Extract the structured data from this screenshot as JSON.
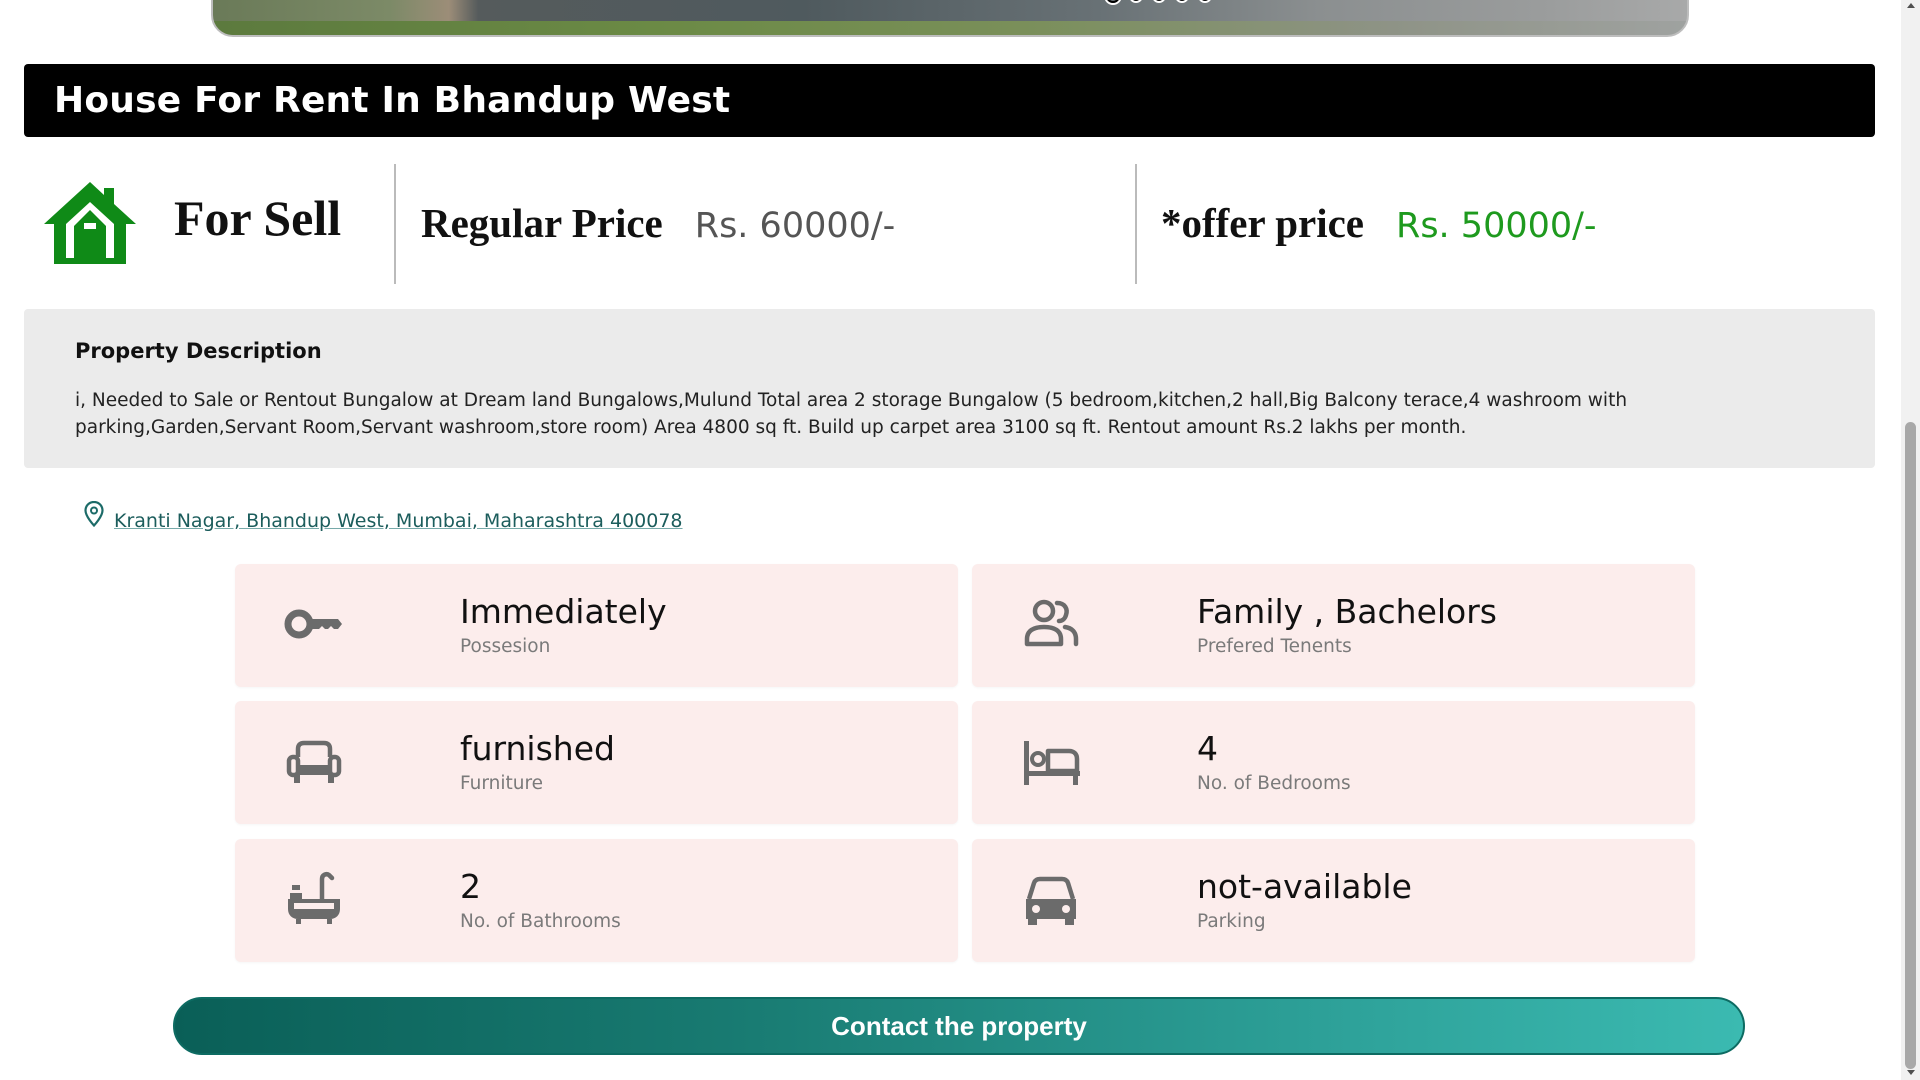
{
  "carousel": {
    "slide_count": 5,
    "active_index": 0
  },
  "header": {
    "title": "House For Rent In Bhandup West"
  },
  "pricing": {
    "sale_type": "For Sell",
    "regular_label": "Regular Price",
    "regular_value": "Rs. 60000/-",
    "offer_label": "*offer price",
    "offer_value": "Rs. 50000/-"
  },
  "description": {
    "heading": "Property Description",
    "text": "i, Needed to Sale or Rentout Bungalow at Dream land Bungalows,Mulund Total area 2 storage Bungalow (5 bedroom,kitchen,2 hall,Big Balcony terace,4 washroom with parking,Garden,Servant Room,Servant washroom,store room) Area 4800 sq ft. Build up carpet area 3100 sq ft. Rentout amount Rs.2 lakhs per month."
  },
  "address": {
    "text": "Kranti Nagar, Bhandup West, Mumbai, Maharashtra 400078"
  },
  "features": [
    {
      "icon": "key-icon",
      "value": "Immediately",
      "label": "Possesion"
    },
    {
      "icon": "people-icon",
      "value": "Family , Bachelors",
      "label": "Prefered Tenents"
    },
    {
      "icon": "sofa-icon",
      "value": "furnished",
      "label": "Furniture"
    },
    {
      "icon": "bed-icon",
      "value": "4",
      "label": "No. of Bedrooms"
    },
    {
      "icon": "bathtub-icon",
      "value": "2",
      "label": "No. of Bathrooms"
    },
    {
      "icon": "car-icon",
      "value": "not-available",
      "label": "Parking"
    }
  ],
  "contact": {
    "label": "Contact the property"
  },
  "colors": {
    "offer_green": "#1e9a1e",
    "house_green": "#0f8a17",
    "card_bg": "#fcedec",
    "button_teal": "#187a71"
  }
}
